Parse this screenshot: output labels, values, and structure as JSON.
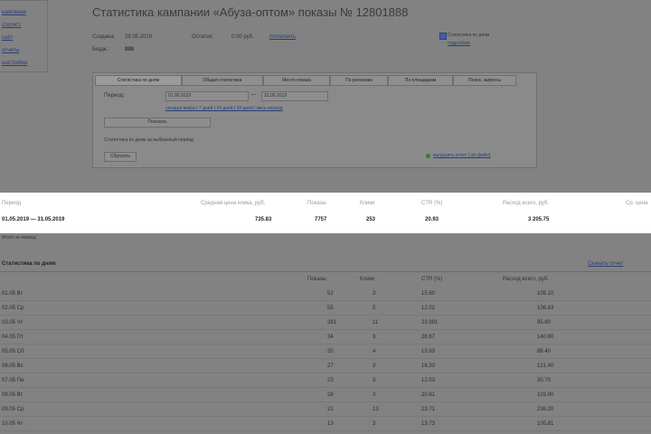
{
  "page": {
    "title": "Статистика кампании «Абуза-оптом» показы № 12801888",
    "meta_date_label": "Создана:",
    "meta_date_value": "28.05.2019",
    "meta_budget_label": "Остаток:",
    "meta_budget_value": "0.00 руб.",
    "meta_budget_link": "пополнить",
    "checkbox_label": "Статистика по дням",
    "checkbox_sub": "подробнее"
  },
  "left_panel": {
    "links": [
      "кампании",
      "статист.",
      "сайт",
      "отчеты",
      "настройки"
    ]
  },
  "tabs": [
    {
      "label": "Статистика по дням",
      "active": true
    },
    {
      "label": "Общая статистика",
      "active": false
    },
    {
      "label": "Место показа",
      "active": false
    },
    {
      "label": "По регионам",
      "active": false
    },
    {
      "label": "По площадкам",
      "active": false
    },
    {
      "label": "Поиск. запросы",
      "active": false
    }
  ],
  "filter": {
    "period_label": "Период:",
    "from_value": "01.05.2019",
    "dash": "—",
    "to_value": "31.05.2019",
    "quick_links": "сегодня вчера | 7 дней | 14 дней | 30 дней | весь период",
    "show_button": "Показать",
    "note": "Статистика по дням за выбранный период",
    "bottom_left_button": "Сбросить",
    "bottom_right_link": "выгрузить отчет (.xls файл)"
  },
  "highlight": {
    "headers": [
      "Период",
      "Средняя цена клика, руб.",
      "Показы",
      "Клики",
      "CTR (%)",
      "Расход всего, руб.",
      "Ср. цена"
    ],
    "values": [
      "01.05.2019 — 31.05.2019",
      "735.83",
      "7757",
      "253",
      "20.93",
      "3 205.75",
      ""
    ]
  },
  "after_band_note": "Итого за период",
  "section": {
    "title": "Статистика по дням",
    "right_link": "Скачать отчет"
  },
  "table": {
    "headers": [
      "",
      "Показы",
      "Клики",
      "CTR (%)",
      "Расход всего, руб."
    ],
    "rows": [
      [
        "01.05 Вт",
        "52",
        "3",
        "15.60",
        "105.10"
      ],
      [
        "02.05 Ср",
        "55",
        "5",
        "12.02",
        "106.83"
      ],
      [
        "03.05 Чт",
        "281",
        "11",
        "23.991",
        "95.80"
      ],
      [
        "04.05 Пт",
        "34",
        "3",
        "28.87",
        "140.60"
      ],
      [
        "05.05 Сб",
        "35",
        "4",
        "13.93",
        "88.40"
      ],
      [
        "06.05 Вс",
        "27",
        "3",
        "16.33",
        "121.40"
      ],
      [
        "07.05 Пн",
        "23",
        "3",
        "12.03",
        "35.70"
      ],
      [
        "08.05 Вт",
        "28",
        "3",
        "20.81",
        "103.90"
      ],
      [
        "09.05 Ср",
        "21",
        "13",
        "23.71",
        "236.20"
      ],
      [
        "10.05 Чт",
        "13",
        "3",
        "13.73",
        "105.81"
      ]
    ]
  }
}
